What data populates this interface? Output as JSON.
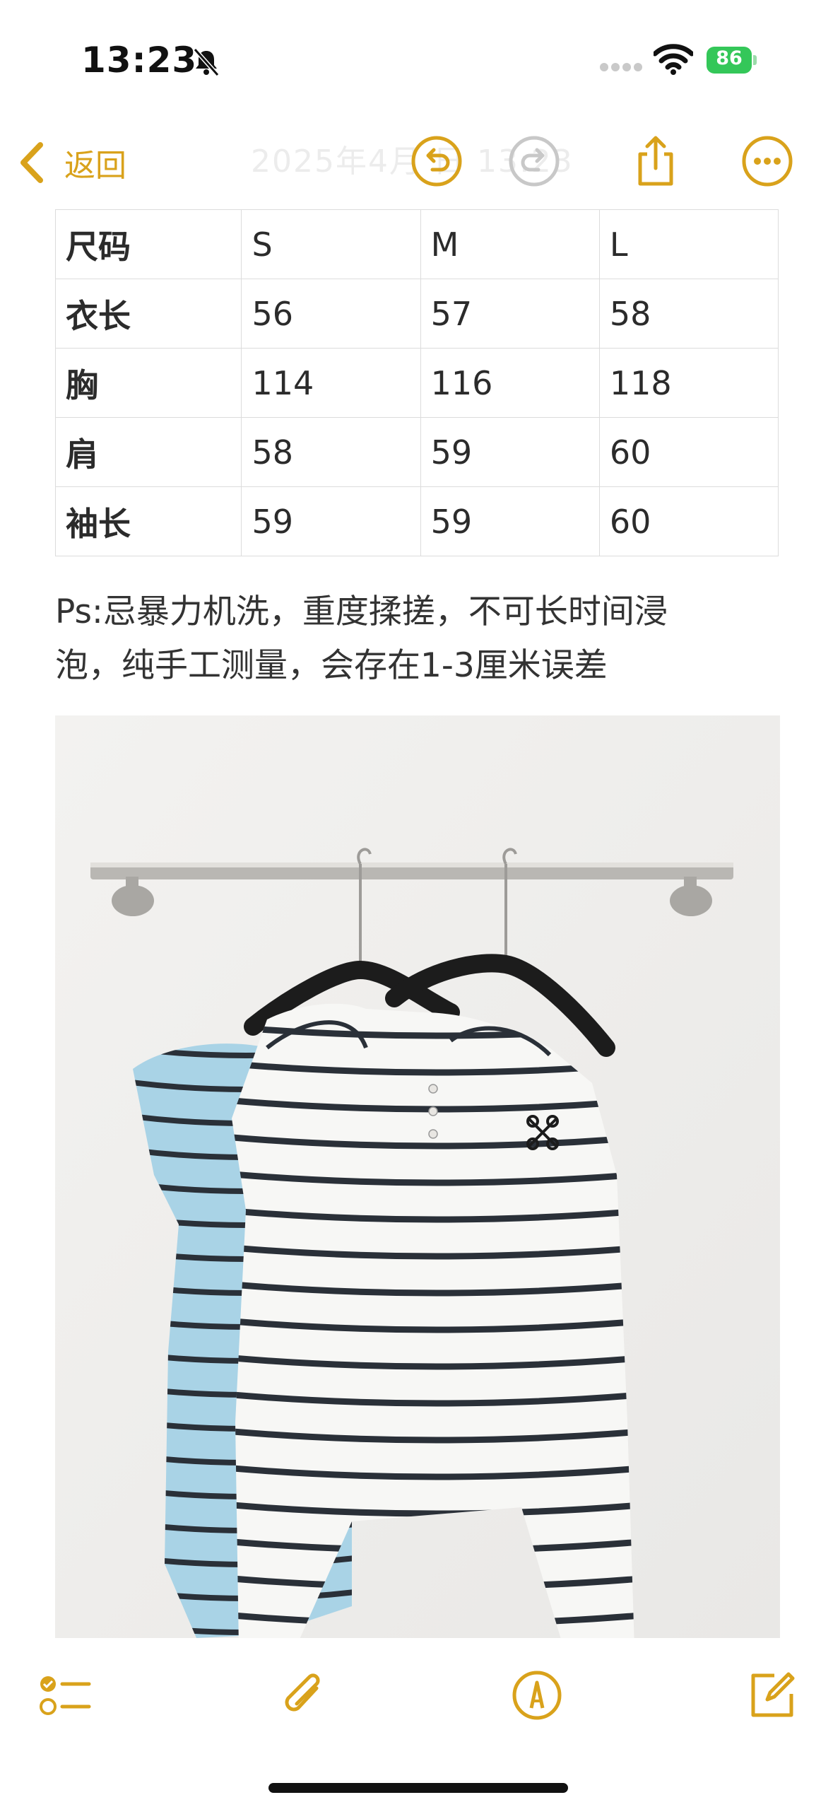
{
  "status_bar": {
    "time": "13:23",
    "battery": "86",
    "colors": {
      "battery": "#34c759"
    }
  },
  "nav": {
    "back_label": "返回",
    "faint_title": "2025年4月  日 13:23",
    "accent": "#d9a21b",
    "icons": [
      "undo-icon",
      "redo-icon",
      "share-icon",
      "more-icon"
    ]
  },
  "size_table": {
    "rows": [
      [
        "尺码",
        "S",
        "M",
        "L"
      ],
      [
        "衣长",
        "56",
        "57",
        "58"
      ],
      [
        "胸",
        "114",
        "116",
        "118"
      ],
      [
        "肩",
        "58",
        "59",
        "60"
      ],
      [
        "袖长",
        "59",
        "59",
        "60"
      ]
    ]
  },
  "note": {
    "line1": "Ps:忌暴力机洗，重度揉搓，不可长时间浸",
    "line2": "泡，纯手工测量，会存在1-3厘米误差"
  },
  "photo": {
    "description": "two striped hooded knit sweaters on hangers",
    "colors": {
      "blue_sweater": "#a9d3e6",
      "white_sweater": "#f7f7f5",
      "stripes": "#2a3038"
    }
  },
  "toolbar": {
    "icons": [
      "checklist-icon",
      "paperclip-icon",
      "markup-pen-icon",
      "compose-icon"
    ]
  }
}
